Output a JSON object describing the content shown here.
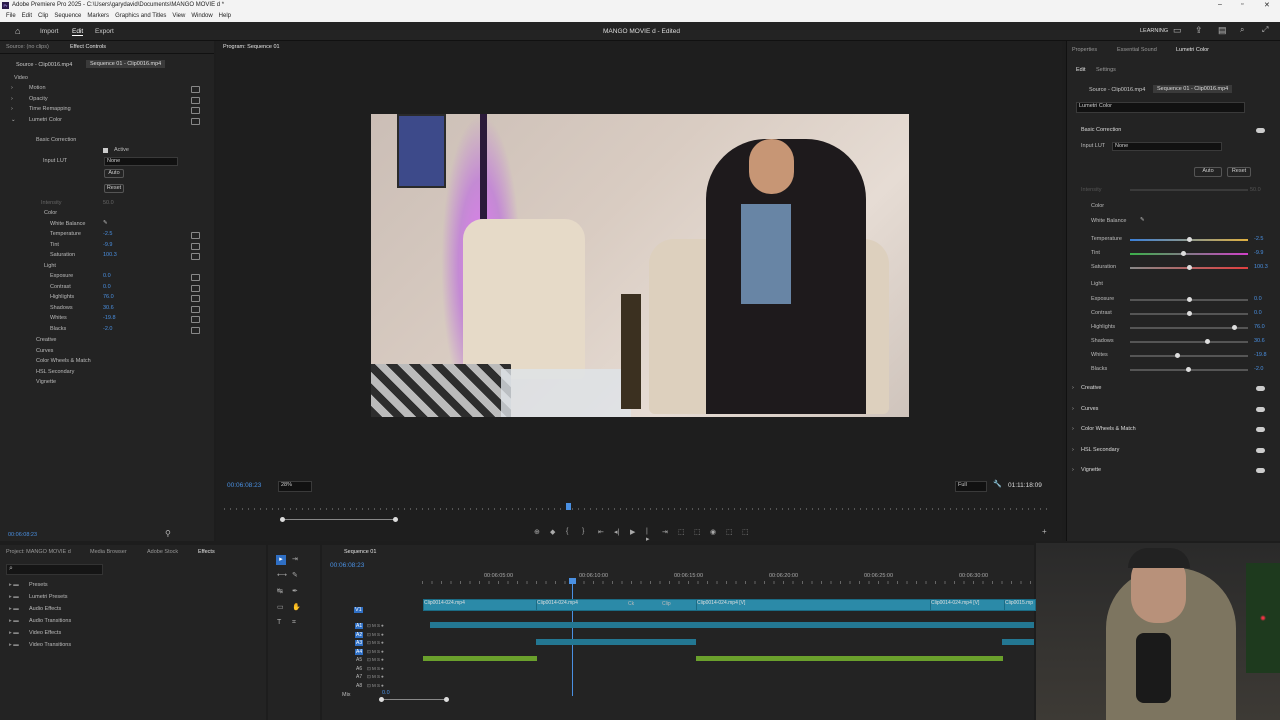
{
  "titlebar": {
    "app_title": "Adobe Premiere Pro 2025 - C:\\Users\\garydavid\\Documents\\MANGO MOVIE d *"
  },
  "menu": [
    "File",
    "Edit",
    "Clip",
    "Sequence",
    "Markers",
    "Graphics and Titles",
    "View",
    "Window",
    "Help"
  ],
  "workspace": {
    "tabs": [
      "Import",
      "Edit",
      "Export"
    ],
    "active": "Edit",
    "project_title": "MANGO MOVIE d - Edited",
    "learning": "LEARNING"
  },
  "effect_controls": {
    "tabs": [
      "Source: (no clips)",
      "Effect Controls"
    ],
    "source_tab": "Source - Clip0016.mp4",
    "seq_tab": "Sequence 01 - Clip0016.mp4",
    "video_label": "Video",
    "effects": [
      "Motion",
      "Opacity",
      "Time Remapping",
      "Lumetri Color"
    ],
    "basic_correction": "Basic Correction",
    "active": "Active",
    "input_lut_label": "Input LUT",
    "input_lut_value": "None",
    "auto": "Auto",
    "reset": "Reset",
    "intensity": "Intensity",
    "intensity_val": "50.0",
    "color": "Color",
    "white_balance": "White Balance",
    "params": [
      {
        "name": "Temperature",
        "value": "-2.5"
      },
      {
        "name": "Tint",
        "value": "-9.9"
      },
      {
        "name": "Saturation",
        "value": "100.3"
      }
    ],
    "light": "Light",
    "light_params": [
      {
        "name": "Exposure",
        "value": "0.0"
      },
      {
        "name": "Contrast",
        "value": "0.0"
      },
      {
        "name": "Highlights",
        "value": "76.0"
      },
      {
        "name": "Shadows",
        "value": "30.6"
      },
      {
        "name": "Whites",
        "value": "-19.8"
      },
      {
        "name": "Blacks",
        "value": "-2.0"
      }
    ],
    "sections": [
      "Creative",
      "Curves",
      "Color Wheels & Match",
      "HSL Secondary",
      "Vignette"
    ],
    "timecode": "00:06:08:23"
  },
  "program": {
    "title": "Program: Sequence 01",
    "timecode": "00:06:08:23",
    "zoom": "28%",
    "quality": "Full",
    "duration": "01:11:18:09"
  },
  "lumetri": {
    "tabs": [
      "Properties",
      "Essential Sound",
      "Lumetri Color"
    ],
    "subtabs": [
      "Edit",
      "Settings"
    ],
    "source_tab": "Source - Clip0016.mp4",
    "seq_tab": "Sequence 01 - Clip0016.mp4",
    "effect_select": "Lumetri Color",
    "basic_correction": "Basic Correction",
    "input_lut_label": "Input LUT",
    "input_lut_value": "None",
    "auto": "Auto",
    "reset": "Reset",
    "intensity": "Intensity",
    "intensity_val": "50.0",
    "color": "Color",
    "white_balance": "White Balance",
    "color_params": [
      {
        "name": "Temperature",
        "value": "-2.5",
        "pos": 0.5
      },
      {
        "name": "Tint",
        "value": "-9.9",
        "pos": 0.45
      },
      {
        "name": "Saturation",
        "value": "100.3",
        "pos": 0.5
      }
    ],
    "light": "Light",
    "light_params": [
      {
        "name": "Exposure",
        "value": "0.0",
        "pos": 0.5
      },
      {
        "name": "Contrast",
        "value": "0.0",
        "pos": 0.5
      },
      {
        "name": "Highlights",
        "value": "76.0",
        "pos": 0.88
      },
      {
        "name": "Shadows",
        "value": "30.6",
        "pos": 0.65
      },
      {
        "name": "Whites",
        "value": "-19.8",
        "pos": 0.4
      },
      {
        "name": "Blacks",
        "value": "-2.0",
        "pos": 0.49
      }
    ],
    "sections": [
      "Creative",
      "Curves",
      "Color Wheels & Match",
      "HSL Secondary",
      "Vignette"
    ]
  },
  "project_panel": {
    "tabs": [
      "Project: MANGO MOVIE d",
      "Media Browser",
      "Adobe Stock",
      "Effects"
    ],
    "folders": [
      "Presets",
      "Lumetri Presets",
      "Audio Effects",
      "Audio Transitions",
      "Video Effects",
      "Video Transitions"
    ]
  },
  "timeline": {
    "tab": "Sequence 01",
    "timecode": "00:06:08:23",
    "ruler": [
      "00:06:05:00",
      "00:06:10:00",
      "00:06:15:00",
      "00:06:20:00",
      "00:06:25:00",
      "00:06:30:00"
    ],
    "tracks_v": [
      "V1"
    ],
    "tracks_a": [
      "A1",
      "A2",
      "A3",
      "A4",
      "A5",
      "A6",
      "A7",
      "A8"
    ],
    "mix": "Mix",
    "mix_val": "0.0",
    "clips": [
      "Clip0014-024.mp4",
      "Clip0014-024.mp4",
      "Ck",
      "Clip",
      "Clip0014-024.mp4 [V]",
      "Clip0014-024.mp4 [V]",
      "Clip0015.mp"
    ]
  }
}
